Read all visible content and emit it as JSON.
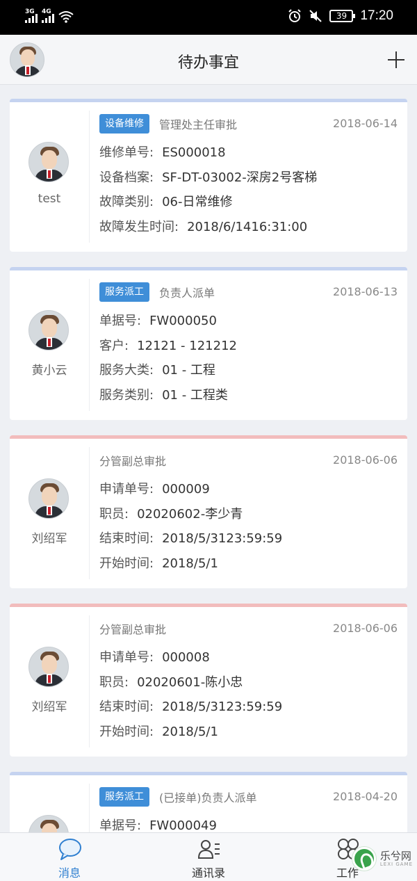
{
  "status_bar": {
    "signal1": "3G",
    "signal2": "4G",
    "battery": "39",
    "time": "17:20"
  },
  "header": {
    "title": "待办事宜"
  },
  "cards": [
    {
      "user": "test",
      "tag": "设备维修",
      "stage": "管理处主任审批",
      "date": "2018-06-14",
      "accent": "#c5d3f0",
      "rows": [
        {
          "label": "维修单号:",
          "value": "ES000018"
        },
        {
          "label": "设备档案:",
          "value": "SF-DT-03002-深房2号客梯"
        },
        {
          "label": "故障类别:",
          "value": "06-日常维修"
        },
        {
          "label": "故障发生时间:",
          "value": "2018/6/1416:31:00"
        }
      ]
    },
    {
      "user": "黄小云",
      "tag": "服务派工",
      "stage": "负责人派单",
      "date": "2018-06-13",
      "accent": "#c5d3f0",
      "rows": [
        {
          "label": "单据号:",
          "value": "FW000050"
        },
        {
          "label": "客户:",
          "value": "12121 - 121212"
        },
        {
          "label": "服务大类:",
          "value": "01 - 工程"
        },
        {
          "label": "服务类别:",
          "value": "01 - 工程类"
        }
      ]
    },
    {
      "user": "刘绍军",
      "tag": "",
      "stage": "分管副总审批",
      "date": "2018-06-06",
      "accent": "#f2bcbc",
      "rows": [
        {
          "label": "申请单号:",
          "value": "000009"
        },
        {
          "label": "职员:",
          "value": "02020602-李少青"
        },
        {
          "label": "结束时间:",
          "value": "2018/5/3123:59:59"
        },
        {
          "label": "开始时间:",
          "value": "2018/5/1"
        }
      ]
    },
    {
      "user": "刘绍军",
      "tag": "",
      "stage": "分管副总审批",
      "date": "2018-06-06",
      "accent": "#f2bcbc",
      "rows": [
        {
          "label": "申请单号:",
          "value": "000008"
        },
        {
          "label": "职员:",
          "value": "02020601-陈小忠"
        },
        {
          "label": "结束时间:",
          "value": "2018/5/3123:59:59"
        },
        {
          "label": "开始时间:",
          "value": "2018/5/1"
        }
      ]
    },
    {
      "user": "",
      "tag": "服务派工",
      "stage": "(已接单)负责人派单",
      "date": "2018-04-20",
      "accent": "#c5d3f0",
      "rows": [
        {
          "label": "单据号:",
          "value": "FW000049"
        }
      ]
    }
  ],
  "tabs": [
    {
      "label": "消息",
      "icon": "chat-bubble-icon",
      "active": true
    },
    {
      "label": "通讯录",
      "icon": "contacts-icon",
      "active": false
    },
    {
      "label": "工作",
      "icon": "clover-icon",
      "active": false
    }
  ],
  "watermark": {
    "text": "乐兮网",
    "sub": "LEXI GAME"
  }
}
